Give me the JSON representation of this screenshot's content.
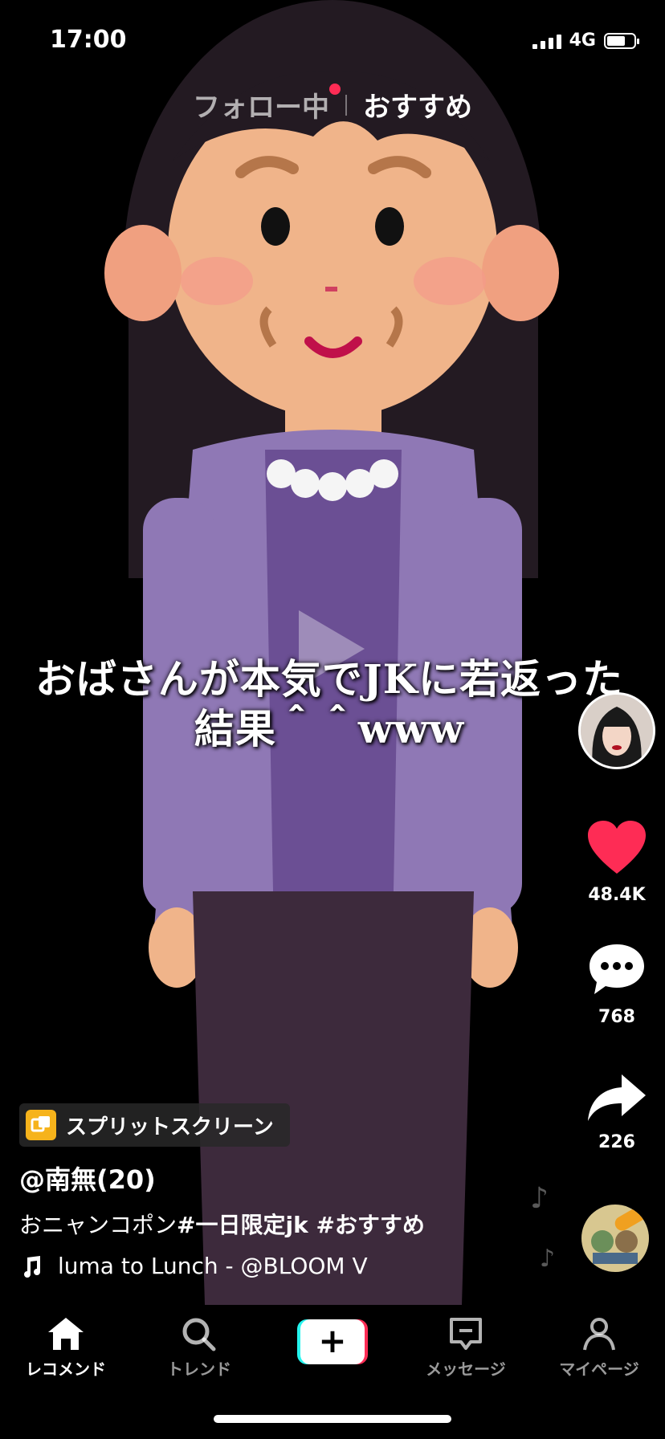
{
  "status_bar": {
    "time": "17:00",
    "network": "4G"
  },
  "top_tabs": {
    "following": "フォロー中",
    "recommended": "おすすめ"
  },
  "video": {
    "caption": "おばさんが本気でJKに若返った結果＾＾www"
  },
  "actions": {
    "likes": "48.4K",
    "comments": "768",
    "shares": "226"
  },
  "effect_label": "スプリットスクリーン",
  "username": "@南無(20)",
  "description": {
    "text": "おニャンコポン",
    "hashtags": "#一日限定jk #おすすめ"
  },
  "music": "luma to Lunch - @BLOOM V",
  "tab_bar": {
    "items": [
      {
        "label": "レコメンド",
        "icon": "home-icon",
        "active": true
      },
      {
        "label": "トレンド",
        "icon": "search-icon",
        "active": false
      },
      {
        "label": "+",
        "icon": "plus-icon",
        "active": false
      },
      {
        "label": "メッセージ",
        "icon": "message-icon",
        "active": false
      },
      {
        "label": "マイページ",
        "icon": "profile-icon",
        "active": false
      }
    ]
  },
  "colors": {
    "accent": "#fe2c55",
    "cyan": "#25f4ee",
    "effect_icon": "#f6b31b"
  }
}
